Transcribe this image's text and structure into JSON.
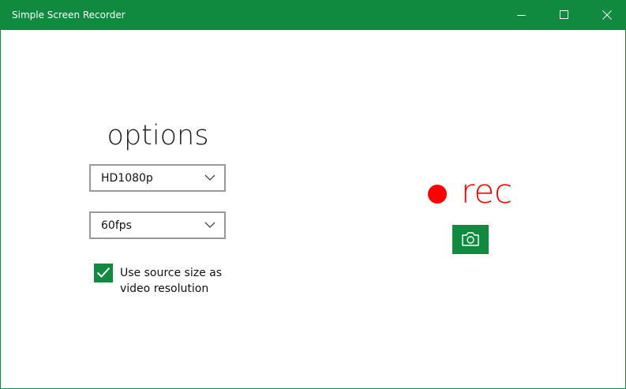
{
  "window": {
    "title": "Simple Screen Recorder"
  },
  "colors": {
    "accent": "#108a3e",
    "record": "#ff0000"
  },
  "options": {
    "title": "options",
    "resolution": {
      "selected": "HD1080p"
    },
    "framerate": {
      "selected": "60fps"
    },
    "use_source_size": {
      "checked": true,
      "label": "Use source size as video resolution"
    }
  },
  "record": {
    "label": "rec",
    "icon": "record-dot-icon"
  },
  "screenshot": {
    "icon": "camera-icon"
  },
  "icons": {
    "minimize": "minimize-icon",
    "maximize": "maximize-icon",
    "close": "close-icon",
    "dropdown": "chevron-down-icon",
    "check": "checkmark-icon"
  }
}
